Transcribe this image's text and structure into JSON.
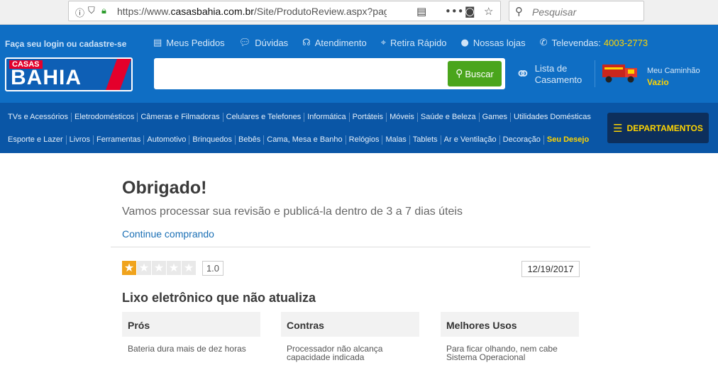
{
  "browser": {
    "url_prefix": "https://www.",
    "url_domain": "casasbahia.com.br",
    "url_path": "/Site/ProdutoReview.aspx?pageI",
    "search_placeholder": "Pesquisar"
  },
  "header": {
    "login_text": "Faça seu login ou cadastre-se",
    "links": [
      {
        "icon": "list-icon",
        "label": "Meus Pedidos"
      },
      {
        "icon": "chat-icon",
        "label": "Dúvidas"
      },
      {
        "icon": "headset-icon",
        "label": "Atendimento"
      },
      {
        "icon": "pin-icon",
        "label": "Retira Rápido"
      },
      {
        "icon": "store-pin-icon",
        "label": "Nossas lojas"
      }
    ],
    "televendas_label": "Televendas:",
    "televendas_number": "4003-2773",
    "logo_top": "CASAS",
    "logo_main": "BAHIA",
    "search_button": "Buscar",
    "lista_line1": "Lista de",
    "lista_line2": "Casamento",
    "cart_label": "Meu Caminhão",
    "cart_status": "Vazio"
  },
  "nav": {
    "row1": [
      "TVs e Acessórios",
      "Eletrodomésticos",
      "Câmeras e Filmadoras",
      "Celulares e Telefones",
      "Informática",
      "Portáteis",
      "Móveis",
      "Saúde e Beleza",
      "Games",
      "Utilidades Domésticas"
    ],
    "row2": [
      "Esporte e Lazer",
      "Livros",
      "Ferramentas",
      "Automotivo",
      "Brinquedos",
      "Bebês",
      "Cama, Mesa e Banho",
      "Relógios",
      "Malas",
      "Tablets",
      "Ar e Ventilação",
      "Decoração"
    ],
    "row2_highlight": "Seu Desejo",
    "departments_button": "DEPARTAMENTOS"
  },
  "content": {
    "title": "Obrigado!",
    "subtitle": "Vamos processar sua revisão e publicá-la dentro de 3 a 7 dias úteis",
    "continue_link": "Continue comprando",
    "rating": 1,
    "rating_max": 5,
    "rating_text": "1.0",
    "date": "12/19/2017",
    "review_title": "Lixo eletrônico que não atualiza",
    "pros_header": "Prós",
    "pros_text": "Bateria dura mais de dez horas",
    "cons_header": "Contras",
    "cons_text": "Processador não alcança capacidade indicada",
    "uses_header": "Melhores Usos",
    "uses_text": "Para ficar olhando, nem cabe Sistema Operacional"
  },
  "colors": {
    "header_blue": "#0f6ec4",
    "nav_blue": "#0a56a6",
    "search_green": "#4aa51c",
    "accent_yellow": "#ffd400",
    "star_orange": "#f0a31c"
  }
}
